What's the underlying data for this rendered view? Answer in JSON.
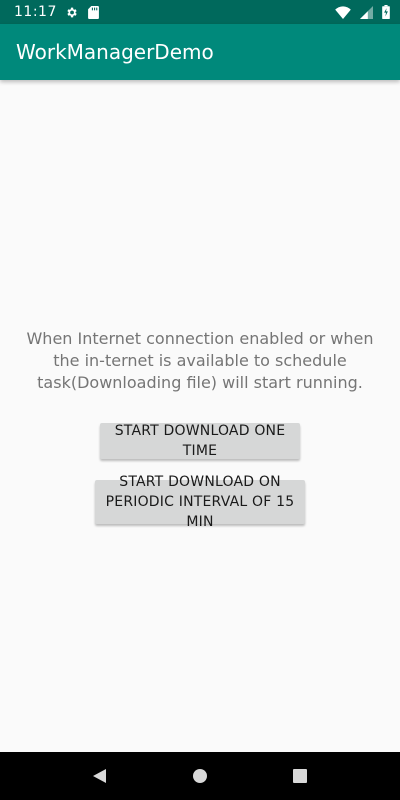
{
  "status_bar": {
    "time": "11:17",
    "icons": [
      "settings-icon",
      "sd-card-icon",
      "wifi-icon",
      "signal-icon",
      "battery-icon"
    ]
  },
  "app_bar": {
    "title": "WorkManagerDemo",
    "color": "#00897b",
    "status_color": "#00695c"
  },
  "main": {
    "message": "When Internet connection enabled or when the in-ternet is available to schedule task(Downloading file) will start running.",
    "buttons": {
      "one_time": "START DOWNLOAD ONE TIME",
      "periodic": "START DOWNLOAD ON PERIODIC INTERVAL OF 15 MIN"
    }
  },
  "nav_bar": {
    "icons": [
      "back-icon",
      "home-icon",
      "recents-icon"
    ]
  }
}
